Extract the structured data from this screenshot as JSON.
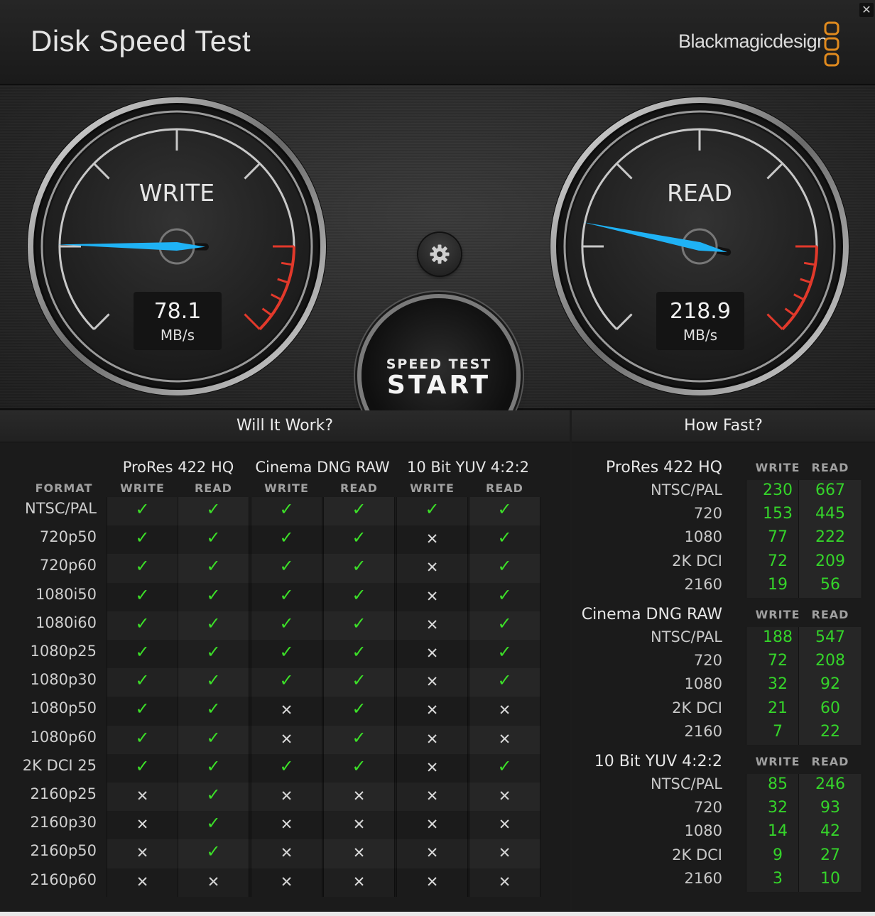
{
  "window": {
    "title": "Disk Speed Test",
    "brand": "Blackmagicdesign",
    "close_glyph": "✕"
  },
  "gauges": {
    "write": {
      "label": "WRITE",
      "value": "78.1",
      "unit": "MB/s",
      "needle_level": 0.17
    },
    "read": {
      "label": "READ",
      "value": "218.9",
      "unit": "MB/s",
      "needle_level": 0.21
    }
  },
  "start_button": {
    "small": "SPEED TEST",
    "big": "START"
  },
  "will_it_work": {
    "title": "Will It Work?",
    "format_header": "FORMAT",
    "codecs": [
      "ProRes 422 HQ",
      "Cinema DNG RAW",
      "10 Bit YUV 4:2:2"
    ],
    "sub_headers": [
      "WRITE",
      "READ",
      "WRITE",
      "READ",
      "WRITE",
      "READ"
    ],
    "rows": [
      {
        "format": "NTSC/PAL",
        "marks": [
          1,
          1,
          1,
          1,
          1,
          1
        ]
      },
      {
        "format": "720p50",
        "marks": [
          1,
          1,
          1,
          1,
          0,
          1
        ]
      },
      {
        "format": "720p60",
        "marks": [
          1,
          1,
          1,
          1,
          0,
          1
        ]
      },
      {
        "format": "1080i50",
        "marks": [
          1,
          1,
          1,
          1,
          0,
          1
        ]
      },
      {
        "format": "1080i60",
        "marks": [
          1,
          1,
          1,
          1,
          0,
          1
        ]
      },
      {
        "format": "1080p25",
        "marks": [
          1,
          1,
          1,
          1,
          0,
          1
        ]
      },
      {
        "format": "1080p30",
        "marks": [
          1,
          1,
          1,
          1,
          0,
          1
        ]
      },
      {
        "format": "1080p50",
        "marks": [
          1,
          1,
          0,
          1,
          0,
          0
        ]
      },
      {
        "format": "1080p60",
        "marks": [
          1,
          1,
          0,
          1,
          0,
          0
        ]
      },
      {
        "format": "2K DCI 25",
        "marks": [
          1,
          1,
          1,
          1,
          0,
          1
        ]
      },
      {
        "format": "2160p25",
        "marks": [
          0,
          1,
          0,
          0,
          0,
          0
        ]
      },
      {
        "format": "2160p30",
        "marks": [
          0,
          1,
          0,
          0,
          0,
          0
        ]
      },
      {
        "format": "2160p50",
        "marks": [
          0,
          1,
          0,
          0,
          0,
          0
        ]
      },
      {
        "format": "2160p60",
        "marks": [
          0,
          0,
          0,
          0,
          0,
          0
        ]
      }
    ]
  },
  "how_fast": {
    "title": "How Fast?",
    "groups": [
      {
        "name": "ProRes 422 HQ",
        "write_header": "WRITE",
        "read_header": "READ",
        "rows": [
          {
            "res": "NTSC/PAL",
            "write": "230",
            "read": "667"
          },
          {
            "res": "720",
            "write": "153",
            "read": "445"
          },
          {
            "res": "1080",
            "write": "77",
            "read": "222"
          },
          {
            "res": "2K DCI",
            "write": "72",
            "read": "209"
          },
          {
            "res": "2160",
            "write": "19",
            "read": "56"
          }
        ]
      },
      {
        "name": "Cinema DNG RAW",
        "write_header": "WRITE",
        "read_header": "READ",
        "rows": [
          {
            "res": "NTSC/PAL",
            "write": "188",
            "read": "547"
          },
          {
            "res": "720",
            "write": "72",
            "read": "208"
          },
          {
            "res": "1080",
            "write": "32",
            "read": "92"
          },
          {
            "res": "2K DCI",
            "write": "21",
            "read": "60"
          },
          {
            "res": "2160",
            "write": "7",
            "read": "22"
          }
        ]
      },
      {
        "name": "10 Bit YUV 4:2:2",
        "write_header": "WRITE",
        "read_header": "READ",
        "rows": [
          {
            "res": "NTSC/PAL",
            "write": "85",
            "read": "246"
          },
          {
            "res": "720",
            "write": "32",
            "read": "93"
          },
          {
            "res": "1080",
            "write": "14",
            "read": "42"
          },
          {
            "res": "2K DCI",
            "write": "9",
            "read": "27"
          },
          {
            "res": "2160",
            "write": "3",
            "read": "10"
          }
        ]
      }
    ]
  },
  "icons": {
    "check": "✓",
    "cross": "✕",
    "settings": "gear-icon",
    "logo": "blackmagic-logo"
  },
  "colors": {
    "needle": "#1fb2f5",
    "redline": "#e2392b",
    "check": "#3ce028",
    "value_green": "#35d42a",
    "logo": "#e08a1e"
  }
}
